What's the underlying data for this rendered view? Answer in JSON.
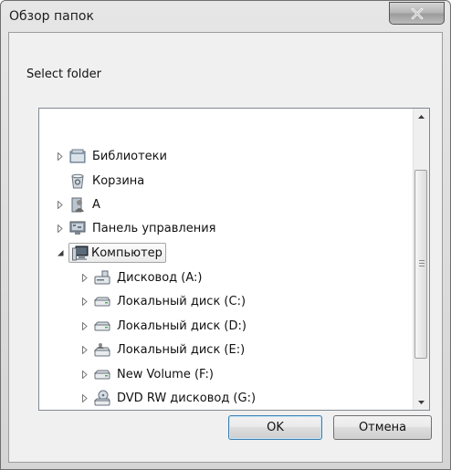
{
  "window": {
    "title": "Обзор папок"
  },
  "dialog": {
    "description": "Select folder"
  },
  "tree": {
    "items": [
      {
        "label": "Библиотеки",
        "icon": "libraries-icon",
        "expander": "collapsed",
        "level": 0
      },
      {
        "label": "Корзина",
        "icon": "recycle-bin-icon",
        "expander": "none",
        "level": 0
      },
      {
        "label": "A",
        "icon": "user-folder-icon",
        "expander": "collapsed",
        "level": 0
      },
      {
        "label": "Панель управления",
        "icon": "control-panel-icon",
        "expander": "collapsed",
        "level": 0
      },
      {
        "label": "Компьютер",
        "icon": "computer-icon",
        "expander": "expanded",
        "level": 0,
        "selected": true
      },
      {
        "label": "Дисковод (A:)",
        "icon": "floppy-drive-icon",
        "expander": "collapsed",
        "level": 1
      },
      {
        "label": "Локальный диск (C:)",
        "icon": "hard-drive-icon",
        "expander": "collapsed",
        "level": 1
      },
      {
        "label": "Локальный диск (D:)",
        "icon": "hard-drive-icon",
        "expander": "collapsed",
        "level": 1
      },
      {
        "label": "Локальный диск (E:)",
        "icon": "shared-drive-icon",
        "expander": "collapsed",
        "level": 1
      },
      {
        "label": "New Volume (F:)",
        "icon": "hard-drive-icon",
        "expander": "collapsed",
        "level": 1
      },
      {
        "label": "DVD RW дисковод (G:)",
        "icon": "dvd-drive-icon",
        "expander": "collapsed",
        "level": 1
      }
    ]
  },
  "buttons": {
    "ok": "OK",
    "cancel": "Отмена"
  },
  "colors": {
    "ok_border": "#3c7fb1",
    "tree_border": "#828790",
    "dialog_bg": "#f0f0f0"
  }
}
